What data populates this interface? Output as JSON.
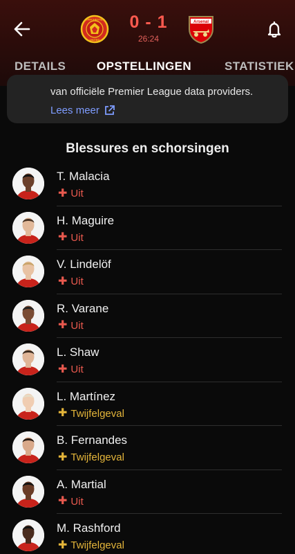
{
  "header": {
    "score": "0 - 1",
    "clock": "26:24",
    "home_crest": "manchester-united-crest",
    "away_crest": "arsenal-crest",
    "home_crest_text": "MANCHESTER UNITED",
    "away_crest_text": "Arsenal",
    "accent_color": "#ff5a4f"
  },
  "tabs": [
    {
      "label": "DETAILS"
    },
    {
      "label": "OPSTELLINGEN"
    },
    {
      "label": "STATISTIEK"
    }
  ],
  "info": {
    "text": "van officiële Premier League data providers.",
    "link": "Lees meer"
  },
  "section_title": "Blessures en schorsingen",
  "players": [
    {
      "name": "T. Malacia",
      "status": "Uit",
      "type": "out"
    },
    {
      "name": "H. Maguire",
      "status": "Uit",
      "type": "out"
    },
    {
      "name": "V. Lindelöf",
      "status": "Uit",
      "type": "out"
    },
    {
      "name": "R. Varane",
      "status": "Uit",
      "type": "out"
    },
    {
      "name": "L. Shaw",
      "status": "Uit",
      "type": "out"
    },
    {
      "name": "L. Martínez",
      "status": "Twijfelgeval",
      "type": "doubt"
    },
    {
      "name": "B. Fernandes",
      "status": "Twijfelgeval",
      "type": "doubt"
    },
    {
      "name": "A. Martial",
      "status": "Uit",
      "type": "out"
    },
    {
      "name": "M. Rashford",
      "status": "Twijfelgeval",
      "type": "doubt"
    }
  ],
  "colors": {
    "out": "#e8594e",
    "doubt": "#e4b53a",
    "link": "#7e9cff"
  }
}
